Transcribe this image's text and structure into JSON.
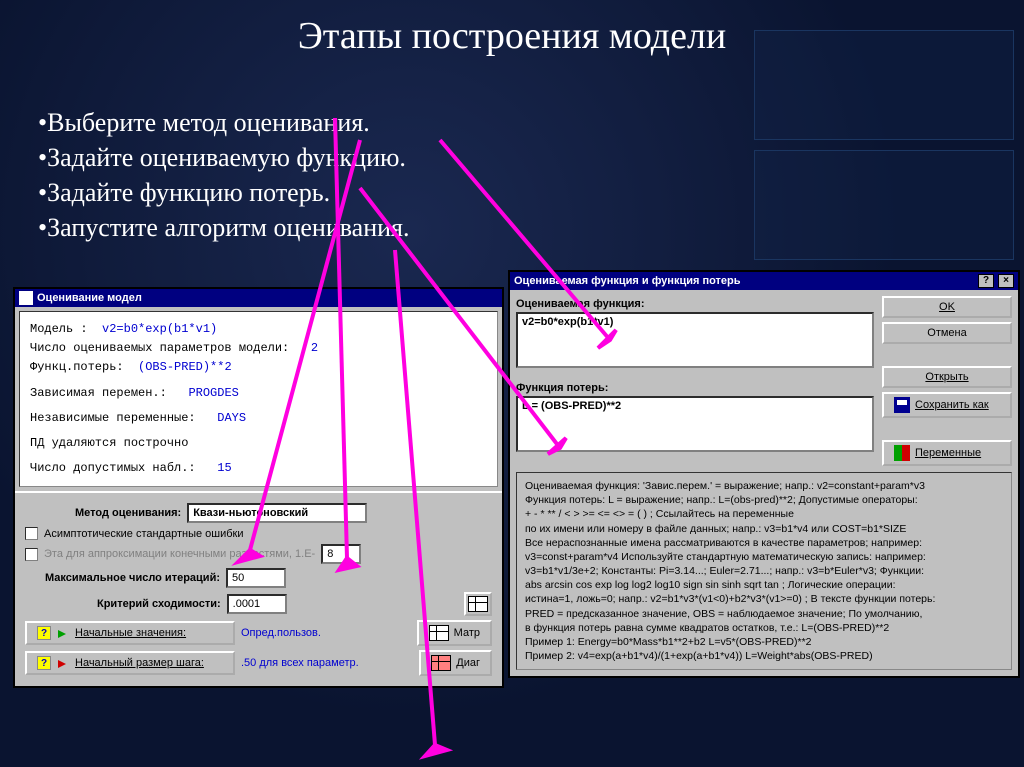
{
  "slide": {
    "title": "Этапы построения модели",
    "bullets": [
      "•Выберите метод оценивания.",
      "•Задайте оцениваемую функцию.",
      "•Задайте функцию потерь.",
      "•Запустите алгоритм оценивания."
    ]
  },
  "win1": {
    "title": "Оценивание модел",
    "model_label": "Модель :",
    "model_value": "v2=b0*exp(b1*v1)",
    "params_label": "Число оцениваемых параметров модели:",
    "params_value": "2",
    "loss_label": "Функц.потерь:",
    "loss_value": "(OBS-PRED)**2",
    "depvar_label": "Зависимая перемен.:",
    "depvar_value": "PROGDES",
    "indep_label": "Независимые переменные:",
    "indep_value": "DAYS",
    "pd_text": "ПД удаляются построчно",
    "obs_label": "Число допустимых набл.:",
    "obs_value": "15",
    "method_label": "Метод оценивания:",
    "method_value": "Квази-ньютоновский",
    "chk1": "Асимптотические стандартные ошибки",
    "chk2": "Эта для аппроксимации конечными разностями, 1.E-",
    "chk2_val": "8",
    "maxiter_label": "Максимальное число итераций:",
    "maxiter_value": "50",
    "conv_label": "Критерий сходимости:",
    "conv_value": ".0001",
    "initial_label": "Начальные значения:",
    "initial_value": "Опред.пользов.",
    "matr_btn": "Матр",
    "step_label": "Начальный размер шага:",
    "step_value": ".50 для всех параметр.",
    "diag_btn": "Диаг"
  },
  "win2": {
    "title": "Оцениваемая функция и функция потерь",
    "func_label": "Оцениваемая функция:",
    "func_value": "v2=b0*exp(b1*v1)",
    "loss_label": "Функция потерь:",
    "loss_value": "L = (OBS-PRED)**2",
    "ok": "OK",
    "cancel": "Отмена",
    "open": "Открыть",
    "save_as": "Сохранить как",
    "vars": "Переменные",
    "hint": "Оцениваемая функция: 'Завис.перем.' = выражение; напр.: v2=constant+param*v3\nФункция потерь: L = выражение;  напр.:  L=(obs-pred)**2; Допустимые операторы:\n+   -   *   **   /   <   >   >=   <=   <>   =   (   ) ; Ссылайтесь на переменные\nпо их имени или номеру в файле данных; напр.: v3=b1*v4  или  COST=b1*SIZE\nВсе нераспознанные имена рассматриваются в качестве параметров; например:\nv3=const+param*v4 Используйте стандартную математическую запись: например:\nv3=b1*v1/3e+2; Константы: Pi=3.14...; Euler=2.71...; напр.: v3=b*Euler*v3; Функции:\nabs arcsin cos exp log log2 log10 sign sin sinh sqrt tan ; Логические операции:\nистина=1, ложь=0; напр.: v2=b1*v3*(v1<0)+b2*v3*(v1>=0) ; В тексте функции потерь:\nPRED = предсказанное значение, OBS = наблюдаемое значение; По умолчанию,\nв функция потерь равна сумме квадратов остатков, т.е.: L=(OBS-PRED)**2\nПример 1: Energy=b0*Mass*b1**2+b2  L=v5*(OBS-PRED)**2\nПример 2: v4=exp(a+b1*v4)/(1+exp(a+b1*v4))  L=Weight*abs(OBS-PRED)"
  }
}
